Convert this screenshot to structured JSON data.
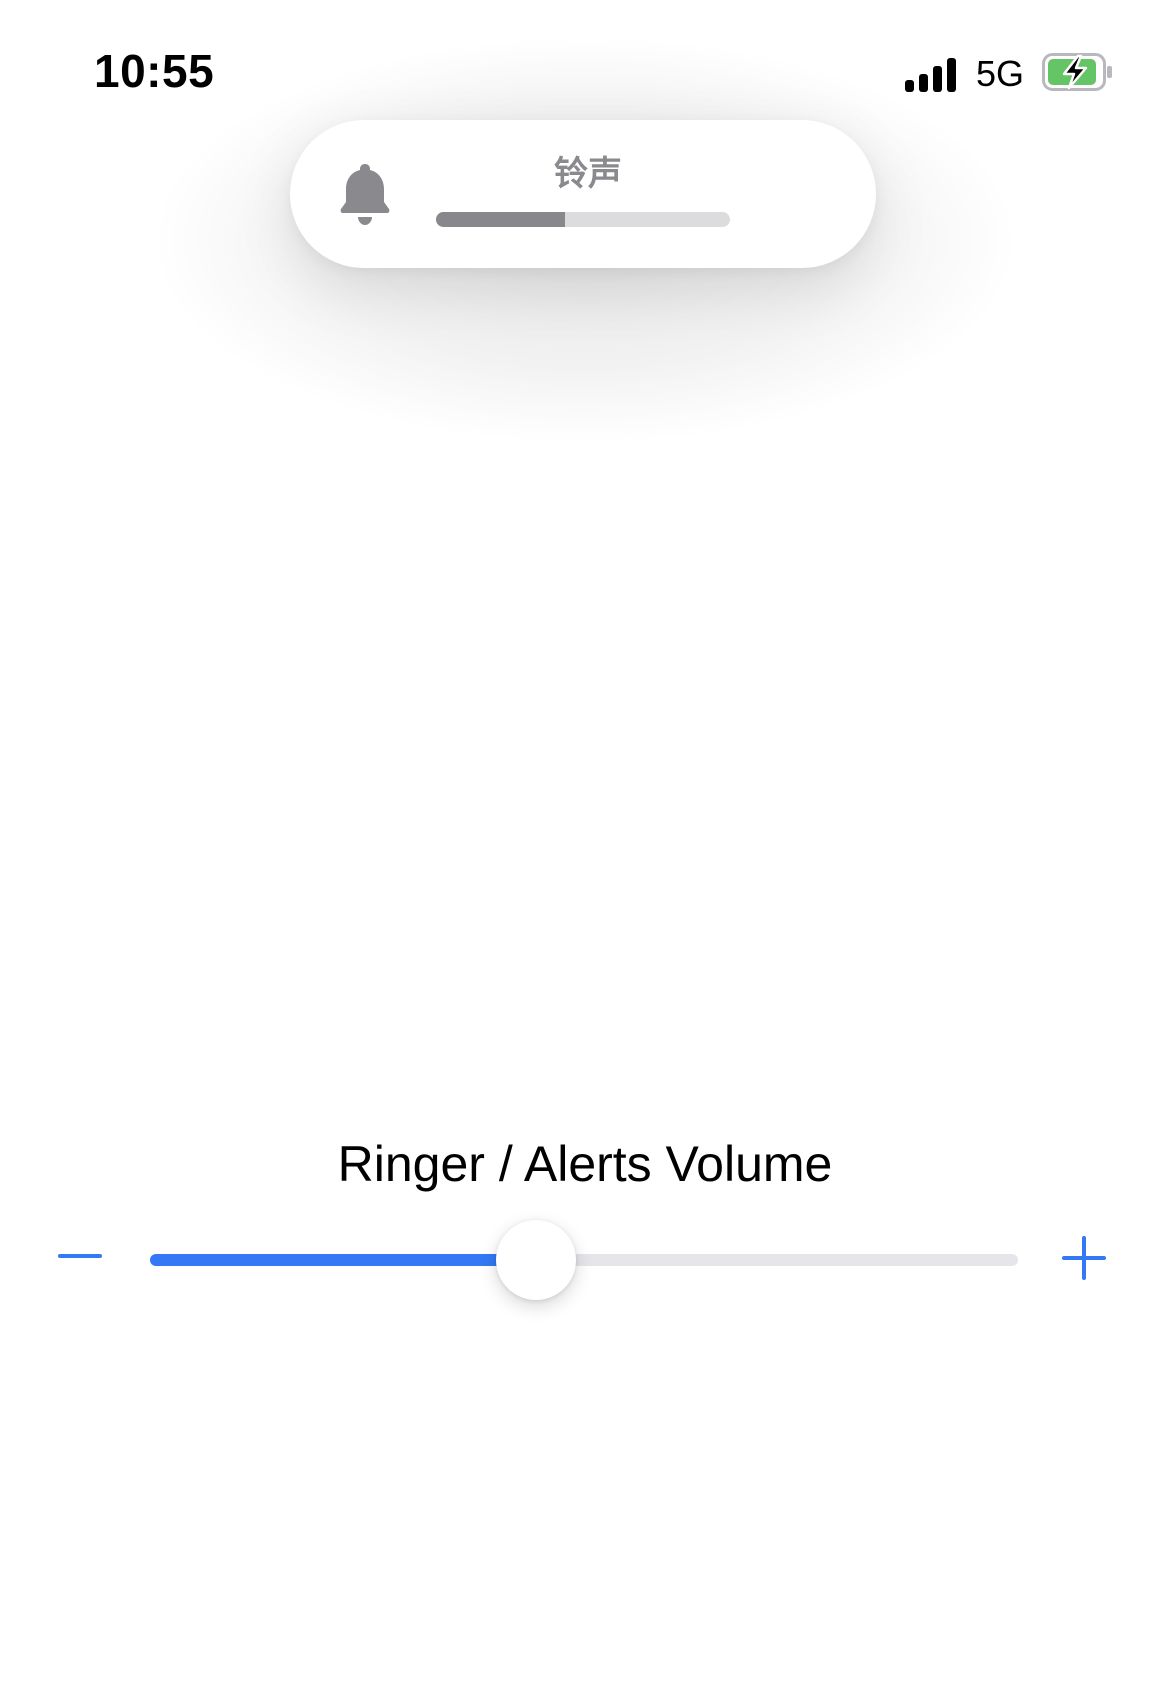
{
  "status_bar": {
    "time": "10:55",
    "network": "5G",
    "icons": [
      "signal-icon",
      "battery-charging-icon"
    ],
    "battery_color": "#65c466"
  },
  "hud": {
    "icon": "bell-icon",
    "label": "铃声",
    "level": 0.44,
    "colors": {
      "fill": "#88888c",
      "track": "#dcdcde",
      "icon": "#8a8a8e"
    }
  },
  "volume": {
    "title": "Ringer / Alerts Volume",
    "level": 0.445,
    "minus_icon": "minus-icon",
    "plus_icon": "plus-icon",
    "colors": {
      "accent": "#3478f6",
      "track": "#e5e5ea"
    }
  }
}
